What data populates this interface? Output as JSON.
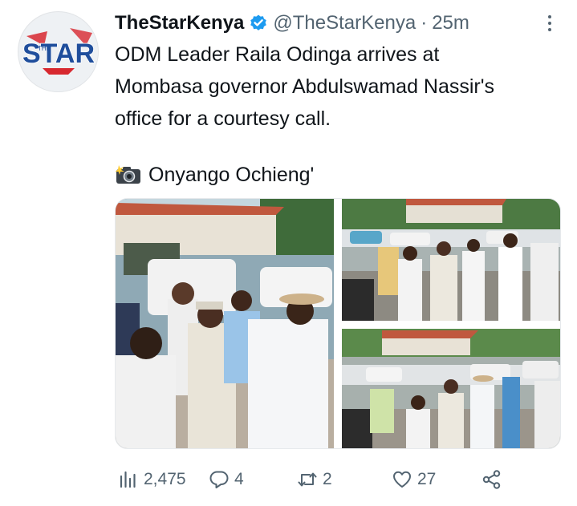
{
  "author": {
    "display_name": "TheStarKenya",
    "handle": "@TheStarKenya",
    "separator": "·",
    "time": "25m",
    "avatar_logo_text": "STAR",
    "verified_color": "#1d9bf0"
  },
  "tweet": {
    "text_lines": [
      "ODM Leader Raila Odinga arrives at",
      "Mombasa governor Abdulswamad Nassir's",
      "office for a courtesy call."
    ],
    "credit": "Onyango Ochieng'"
  },
  "media": {
    "photo_count": 3
  },
  "actions": {
    "views": "2,475",
    "replies": "4",
    "retweets": "2",
    "likes": "27"
  },
  "icons": {
    "verified": "verified-badge-icon",
    "more": "more-options-icon",
    "camera": "camera-flash-emoji",
    "views": "analytics-bars-icon",
    "reply": "reply-bubble-icon",
    "retweet": "retweet-icon",
    "like": "heart-icon",
    "share": "share-nodes-icon"
  },
  "colors": {
    "text": "#0f1419",
    "secondary": "#536471",
    "brand_red": "#d7282f",
    "brand_blue": "#1f4e9c"
  }
}
